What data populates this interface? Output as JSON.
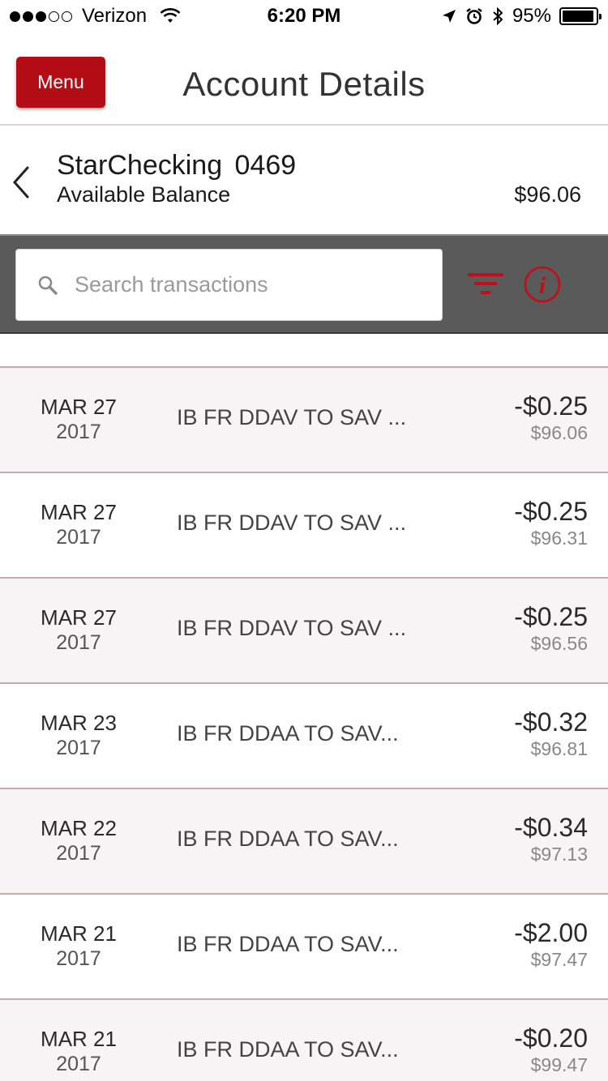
{
  "status_bar": {
    "carrier": "Verizon",
    "time": "6:20 PM",
    "battery_percent": "95%",
    "battery_level": 0.95,
    "signal_bars_filled": 3,
    "signal_bars_total": 5
  },
  "header": {
    "menu_label": "Menu",
    "title": "Account Details"
  },
  "account": {
    "name": "StarChecking 0469",
    "balance_label": "Available Balance",
    "balance_value": "$96.06"
  },
  "search": {
    "placeholder": "Search transactions"
  },
  "colors": {
    "accent": "#b50d16",
    "toolbar_bg": "#5a5a5a",
    "row_divider": "#c9a9a9"
  },
  "transactions": [
    {
      "month_day": "MAR 27",
      "year": "2017",
      "description": "IB FR DDAV TO SAV ...",
      "amount": "-$0.25",
      "running_balance": "$96.06"
    },
    {
      "month_day": "MAR 27",
      "year": "2017",
      "description": "IB FR DDAV TO SAV ...",
      "amount": "-$0.25",
      "running_balance": "$96.31"
    },
    {
      "month_day": "MAR 27",
      "year": "2017",
      "description": "IB FR DDAV TO SAV ...",
      "amount": "-$0.25",
      "running_balance": "$96.56"
    },
    {
      "month_day": "MAR 23",
      "year": "2017",
      "description": "IB FR DDAA TO SAV...",
      "amount": "-$0.32",
      "running_balance": "$96.81"
    },
    {
      "month_day": "MAR 22",
      "year": "2017",
      "description": "IB FR DDAA TO SAV...",
      "amount": "-$0.34",
      "running_balance": "$97.13"
    },
    {
      "month_day": "MAR 21",
      "year": "2017",
      "description": "IB FR DDAA TO SAV...",
      "amount": "-$2.00",
      "running_balance": "$97.47"
    },
    {
      "month_day": "MAR 21",
      "year": "2017",
      "description": "IB FR DDAA TO SAV...",
      "amount": "-$0.20",
      "running_balance": "$99.47"
    }
  ]
}
